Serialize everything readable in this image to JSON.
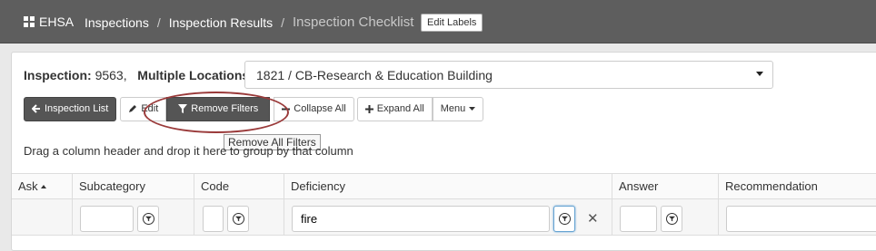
{
  "topbar": {
    "brand": "EHSA",
    "breadcrumbs": [
      "Inspections",
      "Inspection Results"
    ],
    "separator": "/",
    "current": "Inspection Checklist",
    "edit_labels": "Edit Labels"
  },
  "inspection": {
    "label": "Inspection:",
    "number": "9563,",
    "locations_label": "Multiple Locations:",
    "location_value": "1821 / CB-Research & Education Building"
  },
  "toolbar": {
    "inspection_list": "Inspection List",
    "edit": "Edit",
    "remove_filters": "Remove Filters",
    "collapse_all": "Collapse All",
    "expand_all": "Expand All",
    "menu": "Menu"
  },
  "tooltip": "Remove All Filters",
  "group_hint": "Drag a column header and drop it here to group by that column",
  "grid": {
    "columns": [
      "Ask",
      "Subcategory",
      "Code",
      "Deficiency",
      "Answer",
      "Recommendation"
    ],
    "filters": {
      "subcategory": "",
      "code": "",
      "deficiency": "fire",
      "answer": "",
      "recommendation": ""
    }
  }
}
